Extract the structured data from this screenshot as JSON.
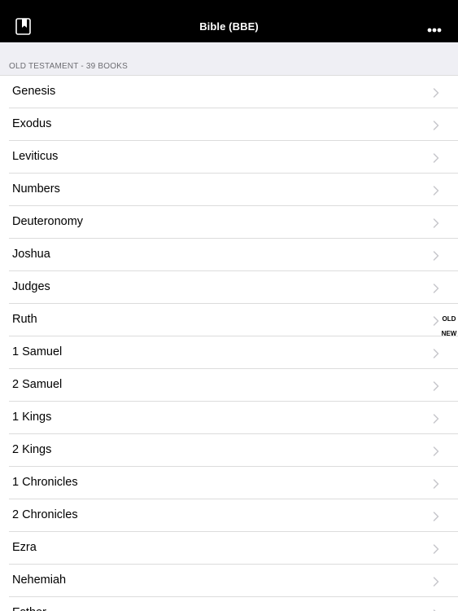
{
  "navbar": {
    "title": "Bible (BBE)",
    "left_icon": "bookmark-book-icon",
    "right_icon": "more-icon"
  },
  "section": {
    "header": "OLD TESTAMENT - 39 BOOKS"
  },
  "books": [
    "Genesis",
    "Exodus",
    "Leviticus",
    "Numbers",
    "Deuteronomy",
    "Joshua",
    "Judges",
    "Ruth",
    "1 Samuel",
    "2 Samuel",
    "1 Kings",
    "2 Kings",
    "1 Chronicles",
    "2 Chronicles",
    "Ezra",
    "Nehemiah",
    "Esther"
  ],
  "index": [
    "OLD",
    "NEW"
  ],
  "colors": {
    "navbar_bg": "#000000",
    "section_bg": "#efeff4",
    "separator": "#dcdcdc",
    "chevron": "#c7c7cc"
  }
}
